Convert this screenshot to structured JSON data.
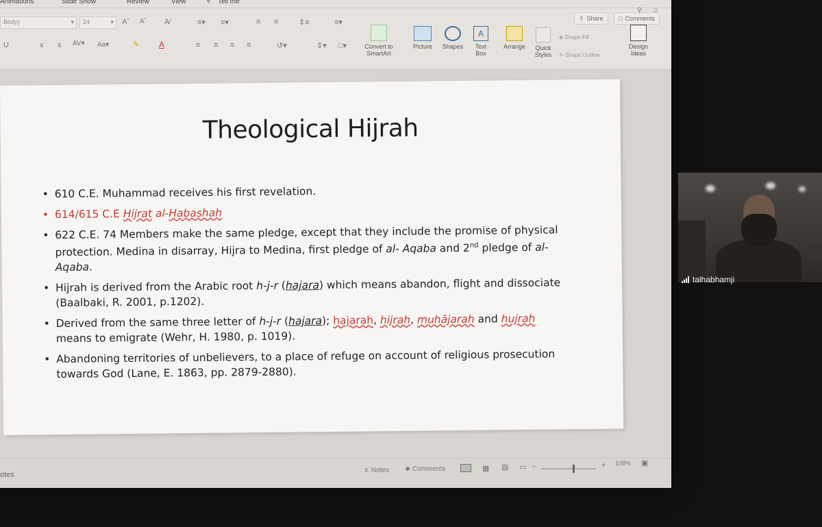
{
  "menu": {
    "animations": "Animations",
    "slideshow": "Slide Show",
    "review": "Review",
    "view": "View",
    "tellme": "Tell me"
  },
  "ribbon": {
    "font_name": "Body)",
    "font_size": "24",
    "share": "Share",
    "comments": "Comments",
    "convert_smartart": "Convert to SmartArt",
    "picture": "Picture",
    "shapes": "Shapes",
    "textbox": "Text Box",
    "arrange": "Arrange",
    "quick_styles": "Quick Styles",
    "shape_fill": "Shape Fill",
    "shape_outline": "Shape Outline",
    "design_ideas": "Design Ideas"
  },
  "slide": {
    "title": "Theological Hijrah",
    "b1": "610 C.E. Muhammad receives his first revelation.",
    "b2_prefix": "614/615 C.E ",
    "b2_link": "Hijrat",
    "b2_rest": " al-",
    "b2_link2": "Habashah",
    "b3_a": "622 C.E. 74 Members make the same pledge, except that they include the promise of physical protection. Medina in disarray, Hijra to Medina, first pledge of ",
    "b3_i1": "al- Aqaba",
    "b3_b": " and 2",
    "b3_sup": "nd",
    "b3_c": " pledge of ",
    "b3_i2": "al-Aqaba",
    "b3_d": ".",
    "b4_a": "Hijrah is derived from the Arabic root ",
    "b4_i1": "h-j-r",
    "b4_b": " (",
    "b4_i2": "hajara",
    "b4_c": ") which means abandon, flight and dissociate (Baalbaki, R. 2001, p.1202).",
    "b5_a": "Derived from the same three letter of ",
    "b5_i1": "h-j-r",
    "b5_b": " (",
    "b5_i2": "hajara",
    "b5_c": "); ",
    "b5_w1": "hajarah",
    "b5_sep1": ", ",
    "b5_w2": "hijrah",
    "b5_sep2": ", ",
    "b5_w3": "muhājarah",
    "b5_and": " and ",
    "b5_w4": "hujrah",
    "b5_d": " means to emigrate (Wehr, H. 1980, p. 1019).",
    "b6": "Abandoning territories of unbelievers, to a place of refuge on account of religious prosecution towards God (Lane, E. 1863, pp. 2879-2880)."
  },
  "status": {
    "notes_left": "otes",
    "notes": "Notes",
    "comments": "Comments",
    "zoom": "108%"
  },
  "webcam": {
    "username": "talhabhamji"
  },
  "colors": {
    "accent_red": "#c33b33",
    "slide_bg": "#f7f6f4",
    "window_bg": "#d9d6d2"
  }
}
